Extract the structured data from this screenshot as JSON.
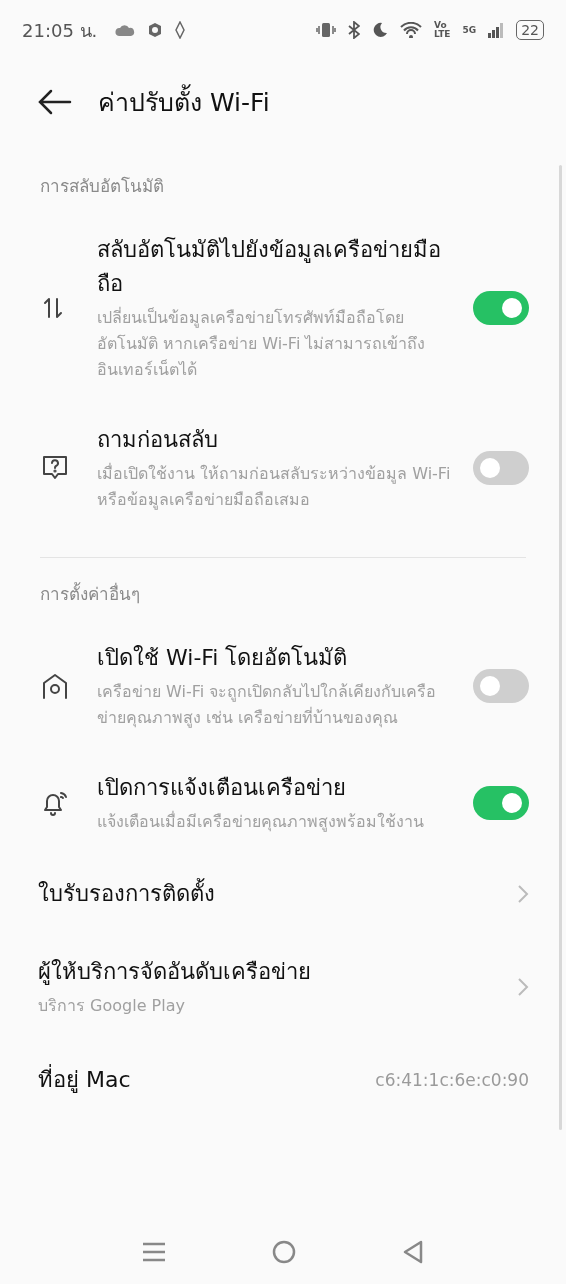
{
  "status_bar": {
    "time": "21:05 น.",
    "volte_top": "Vo",
    "volte_bottom": "LTE",
    "network": "5G",
    "battery": "22"
  },
  "header": {
    "title": "ค่าปรับตั้ง Wi-Fi"
  },
  "sections": [
    {
      "label": "การสลับอัตโนมัติ",
      "items": [
        {
          "kind": "toggle",
          "title": "สลับอัตโนมัติไปยังข้อมูลเครือข่ายมือถือ",
          "description": "เปลี่ยนเป็นข้อมูลเครือข่ายโทรศัพท์มือถือโดยอัตโนมัติ หากเครือข่าย Wi-Fi ไม่สามารถเข้าถึงอินเทอร์เน็ตได้",
          "on": true
        },
        {
          "kind": "toggle",
          "title": "ถามก่อนสลับ",
          "description": "เมื่อเปิดใช้งาน ให้ถามก่อนสลับระหว่างข้อมูล Wi-Fi หรือข้อมูลเครือข่ายมือถือเสมอ",
          "on": false
        }
      ]
    },
    {
      "label": "การตั้งค่าอื่นๆ",
      "items": [
        {
          "kind": "toggle",
          "title": "เปิดใช้ Wi-Fi โดยอัตโนมัติ",
          "description": "เครือข่าย Wi-Fi จะถูกเปิดกลับไปใกล้เคียงกับเครือข่ายคุณภาพสูง เช่น เครือข่ายที่บ้านของคุณ",
          "on": false
        },
        {
          "kind": "toggle",
          "title": "เปิดการแจ้งเตือนเครือข่าย",
          "description": "แจ้งเตือนเมื่อมีเครือข่ายคุณภาพสูงพร้อมใช้งาน",
          "on": true
        },
        {
          "kind": "link",
          "title": "ใบรับรองการติดตั้ง"
        },
        {
          "kind": "link",
          "title": "ผู้ให้บริการจัดอันดับเครือข่าย",
          "description": "บริการ Google Play"
        },
        {
          "kind": "value",
          "title": "ที่อยู่ Mac",
          "value": "c6:41:1c:6e:c0:90"
        }
      ]
    }
  ]
}
